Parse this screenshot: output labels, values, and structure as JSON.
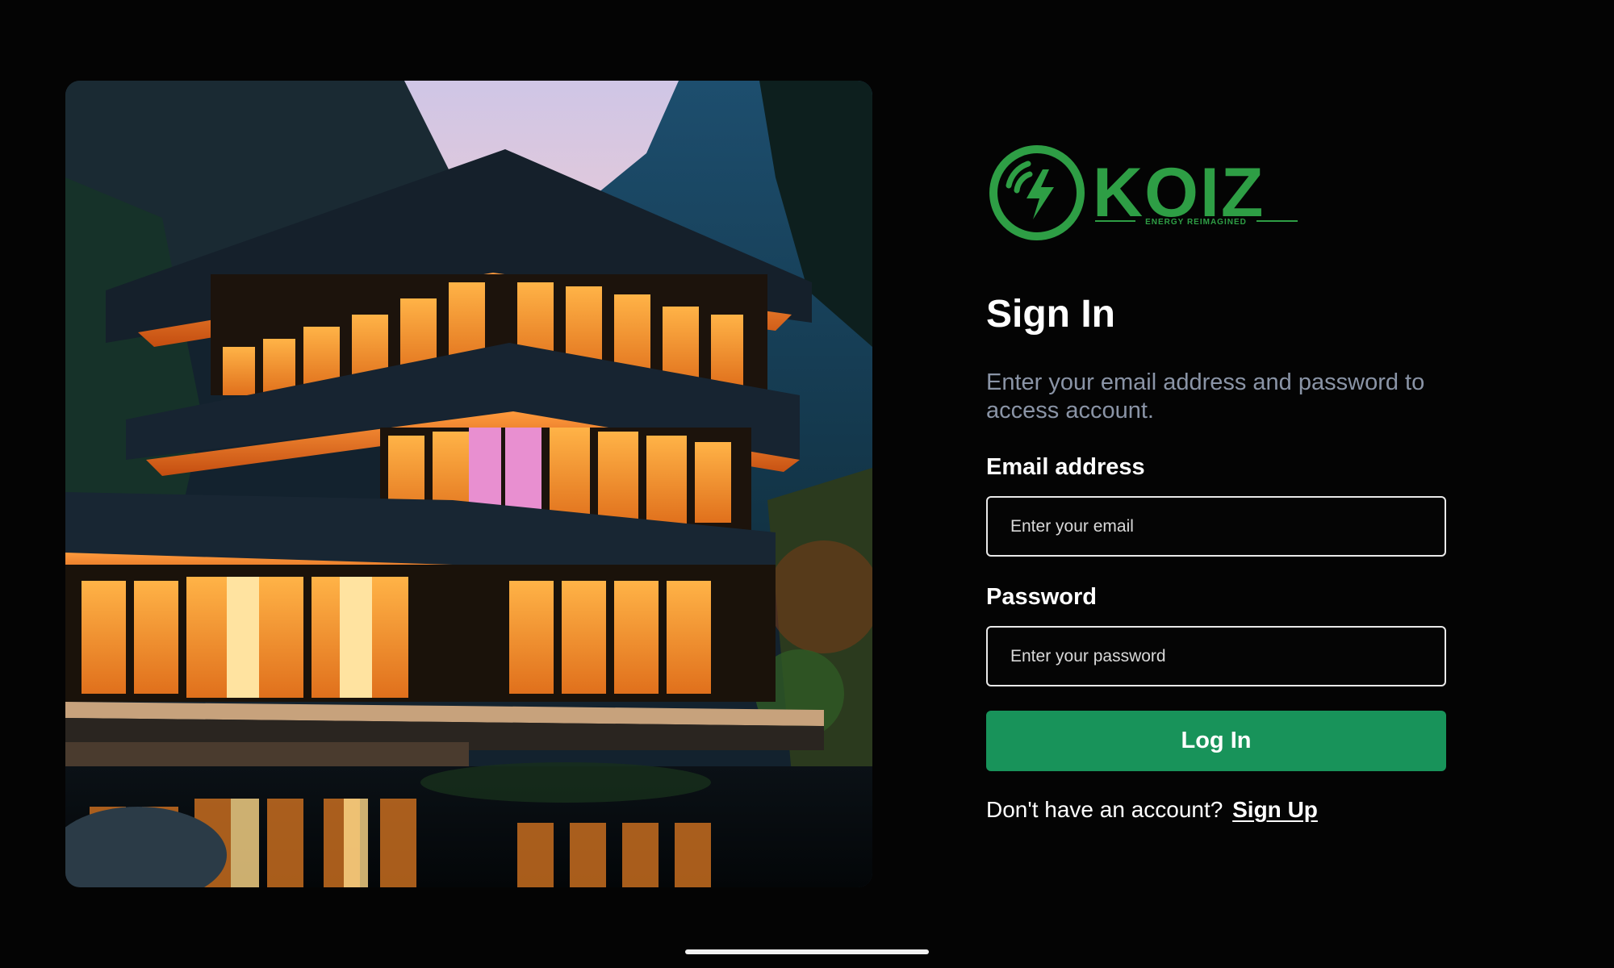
{
  "brand": {
    "name": "KOIZ",
    "tagline": "ENERGY REIMAGINED",
    "accent_color": "#2e9e45"
  },
  "hero": {
    "image": "modern-house-at-dusk"
  },
  "form": {
    "title": "Sign In",
    "subtitle": "Enter your email address and password to access account.",
    "email_label": "Email address",
    "email_placeholder": "Enter your email",
    "email_value": "",
    "password_label": "Password",
    "password_placeholder": "Enter your password",
    "password_value": "",
    "login_label": "Log In",
    "login_color": "#18935a",
    "signup_prompt": "Don't have an account?",
    "signup_link": "Sign Up"
  }
}
